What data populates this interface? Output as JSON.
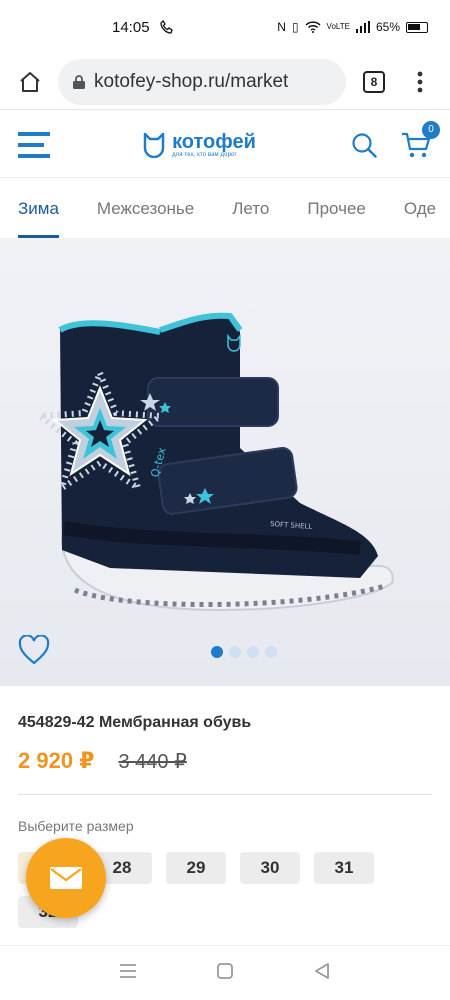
{
  "status": {
    "time": "14:05",
    "battery": "65%"
  },
  "browser": {
    "url": "kotofey-shop.ru/market",
    "tabs_count": "8"
  },
  "site": {
    "logo_main": "котофей",
    "logo_sub": "для тех, кто вам дорог",
    "cart_count": "0"
  },
  "categories": [
    {
      "label": "Зима",
      "active": true
    },
    {
      "label": "Межсезонье"
    },
    {
      "label": "Лето"
    },
    {
      "label": "Прочее"
    },
    {
      "label": "Оде"
    }
  ],
  "product": {
    "title": "454829-42 Мембранная обувь",
    "price": "2 920 ₽",
    "old_price": "3 440 ₽",
    "boot_text_1": "Q-tex",
    "boot_text_2": "SOFT SHELL",
    "size_label": "Выберите размер",
    "sizes": [
      "27",
      "28",
      "29",
      "30",
      "31",
      "32"
    ]
  },
  "gallery": {
    "count": 4,
    "active": 0
  },
  "colors": {
    "accent": "#1e7cc8",
    "price": "#f0931f",
    "fab": "#f7a51e",
    "boot_navy": "#16223a",
    "boot_turquoise": "#3fc3d8"
  }
}
